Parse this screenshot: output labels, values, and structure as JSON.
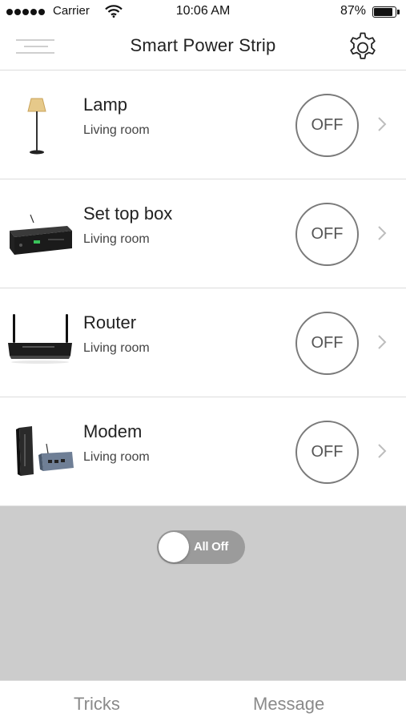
{
  "status_bar": {
    "carrier": "Carrier",
    "time": "10:06 AM",
    "battery_percent": "87%",
    "battery_level": 0.87,
    "signal_icon": "signal-dots-icon",
    "wifi_icon": "wifi-icon"
  },
  "header": {
    "title": "Smart Power Strip",
    "menu_icon": "hamburger-menu-icon",
    "settings_icon": "gear-icon"
  },
  "devices": [
    {
      "name": "Lamp",
      "room": "Living room",
      "state": "OFF",
      "icon": "lamp-icon"
    },
    {
      "name": "Set top box",
      "room": "Living room",
      "state": "OFF",
      "icon": "set-top-box-icon"
    },
    {
      "name": "Router",
      "room": "Living room",
      "state": "OFF",
      "icon": "router-icon"
    },
    {
      "name": "Modem",
      "room": "Living room",
      "state": "OFF",
      "icon": "modem-icon"
    }
  ],
  "all_toggle": {
    "label": "All Off",
    "on": false
  },
  "tabs": [
    {
      "label": "Tricks"
    },
    {
      "label": "Message"
    }
  ],
  "colors": {
    "control_area_bg": "#cccccc",
    "toggle_track": "#9b9b9b",
    "divider": "#dcdcdc"
  }
}
